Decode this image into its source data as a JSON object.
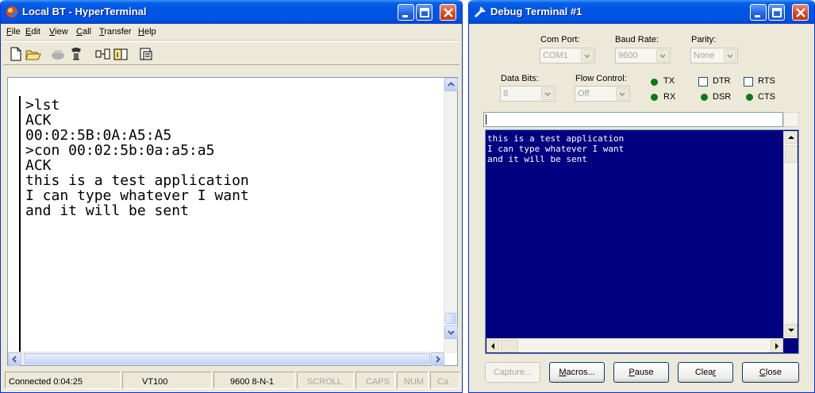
{
  "hyperterminal": {
    "title": "Local BT - HyperTerminal",
    "menu": [
      {
        "mnemonic": "F",
        "rest": "ile"
      },
      {
        "mnemonic": "E",
        "rest": "dit"
      },
      {
        "mnemonic": "V",
        "rest": "iew"
      },
      {
        "mnemonic": "C",
        "rest": "all"
      },
      {
        "mnemonic": "T",
        "rest": "ransfer"
      },
      {
        "mnemonic": "H",
        "rest": "elp"
      }
    ],
    "toolbar_icons": [
      "new-file-icon",
      "open-folder-icon",
      "disconnect-phone-icon",
      "connect-phone-icon",
      "send-file-icon",
      "receive-file-icon",
      "properties-icon"
    ],
    "terminal_lines": [
      ">lst",
      "ACK",
      "00:02:5B:0A:A5:A5",
      ">con 00:02:5b:0a:a5:a5",
      "ACK",
      "this is a test application",
      "I can type whatever I want",
      "and it will be sent"
    ],
    "status": {
      "connected": "Connected 0:04:25",
      "emulation": "VT100",
      "settings": "9600 8-N-1",
      "scroll": "SCROLL",
      "caps": "CAPS",
      "num": "NUM",
      "capture": "Ca"
    }
  },
  "debug_terminal": {
    "title": "Debug Terminal #1",
    "com_port_label": "Com Port:",
    "com_port_value": "COM1",
    "baud_rate_label": "Baud Rate:",
    "baud_rate_value": "9600",
    "parity_label": "Parity:",
    "parity_value": "None",
    "data_bits_label": "Data Bits:",
    "data_bits_value": "8",
    "flow_control_label": "Flow Control:",
    "flow_control_value": "Off",
    "tx_label": "TX",
    "rx_label": "RX",
    "dtr_label": "DTR",
    "rts_label": "RTS",
    "dsr_label": "DSR",
    "cts_label": "CTS",
    "led_color": "#0c7a17",
    "receive_lines": [
      "this is a test application",
      "I can type whatever I want",
      "and it will be sent"
    ],
    "buttons": {
      "capture": "Capture...",
      "macros": "Macros...",
      "pause": "Pause",
      "clear": "Clear",
      "close": "Close"
    }
  }
}
